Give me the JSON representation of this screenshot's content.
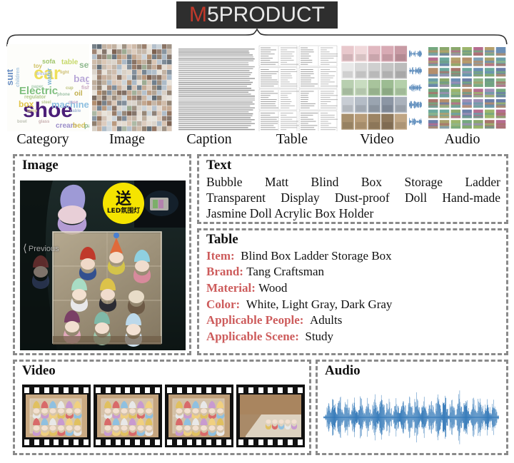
{
  "title": {
    "accent_char": "M",
    "rest": "5PRODUCT",
    "accent_color": "#c0392b",
    "text_color": "#e8e8e8",
    "bar_color": "#2e2e2e"
  },
  "modalities": [
    {
      "key": "category",
      "label": "Category"
    },
    {
      "key": "image",
      "label": "Image"
    },
    {
      "key": "caption",
      "label": "Caption"
    },
    {
      "key": "table",
      "label": "Table"
    },
    {
      "key": "video",
      "label": "Video"
    },
    {
      "key": "audio",
      "label": "Audio"
    }
  ],
  "category_wordcloud": {
    "words": [
      "shoe",
      "car",
      "Electric",
      "box",
      "bag",
      "suit",
      "set",
      "table",
      "sofa",
      "machine",
      "water",
      "cream",
      "bed",
      "pants",
      "oil",
      "toy",
      "children",
      "regulator",
      "fish",
      "dress",
      "light",
      "paper",
      "cup",
      "bowl",
      "glass",
      "cable",
      "lamp",
      "phone",
      "case",
      "steel"
    ],
    "dominant_word": "shoe",
    "dominant_color": "#4b1e78"
  },
  "panels": {
    "image": {
      "title": "Image",
      "nav_label": "Previous",
      "badge_main": "送",
      "badge_sub": "LED氛围灯",
      "badge_color": "#f5e400"
    },
    "text": {
      "title": "Text",
      "lines": [
        "Bubble Matt Blind Box Storage Ladder",
        "Transparent Display Dust-proof Doll Hand-made",
        "Jasmine Doll Acrylic Box Holder"
      ]
    },
    "table": {
      "title": "Table",
      "key_color": "#cd5c5c",
      "rows": [
        {
          "key": "Item:",
          "value": "Blind Box Ladder Storage Box"
        },
        {
          "key": "Brand:",
          "value": "Tang Craftsman"
        },
        {
          "key": "Material:",
          "value": "Wood"
        },
        {
          "key": "Color:",
          "value": "White, Light Gray, Dark Gray"
        },
        {
          "key": "Applicable People:",
          "value": "Adults"
        },
        {
          "key": "Applicable Scene:",
          "value": "Study"
        }
      ]
    },
    "video": {
      "title": "Video",
      "frame_count": 4
    },
    "audio": {
      "title": "Audio",
      "waveform_color": "#2e75b6"
    }
  },
  "chart_data": {
    "type": "line",
    "title": "Audio",
    "xlabel": "",
    "ylabel": "",
    "grid": false,
    "legend": "none",
    "ylim": [
      -1,
      1
    ],
    "series": [
      {
        "name": "amplitude",
        "values": [
          0.05,
          0.1,
          0.42,
          0.55,
          0.3,
          0.62,
          0.48,
          0.22,
          0.58,
          0.75,
          0.4,
          0.18,
          0.52,
          0.66,
          0.34,
          0.12,
          0.45,
          0.7,
          0.38,
          0.2,
          0.6,
          0.82,
          0.44,
          0.16,
          0.5,
          0.68,
          0.36,
          0.14,
          0.55,
          0.78,
          0.42,
          0.24,
          0.64,
          0.88,
          0.46,
          0.18,
          0.52,
          0.72,
          0.34,
          0.1,
          0.48,
          0.66,
          0.4,
          0.22,
          0.58,
          0.8,
          0.44,
          0.12,
          0.5,
          0.74,
          0.38,
          0.16,
          0.62,
          0.86,
          0.42,
          0.2,
          0.54,
          0.7,
          0.36,
          0.14,
          0.46,
          0.68,
          0.4,
          0.18,
          0.56,
          0.84,
          0.48,
          0.22,
          0.6,
          0.76,
          0.32,
          0.1,
          0.44,
          0.64,
          0.38,
          0.16,
          0.52,
          0.9,
          0.46,
          0.2,
          0.58,
          0.72,
          0.34,
          0.12,
          0.5,
          0.78,
          0.42,
          0.24,
          0.62,
          0.82,
          0.4,
          0.18,
          0.48,
          0.66,
          0.36,
          0.14,
          0.54,
          0.7,
          0.3,
          0.08
        ]
      }
    ]
  }
}
